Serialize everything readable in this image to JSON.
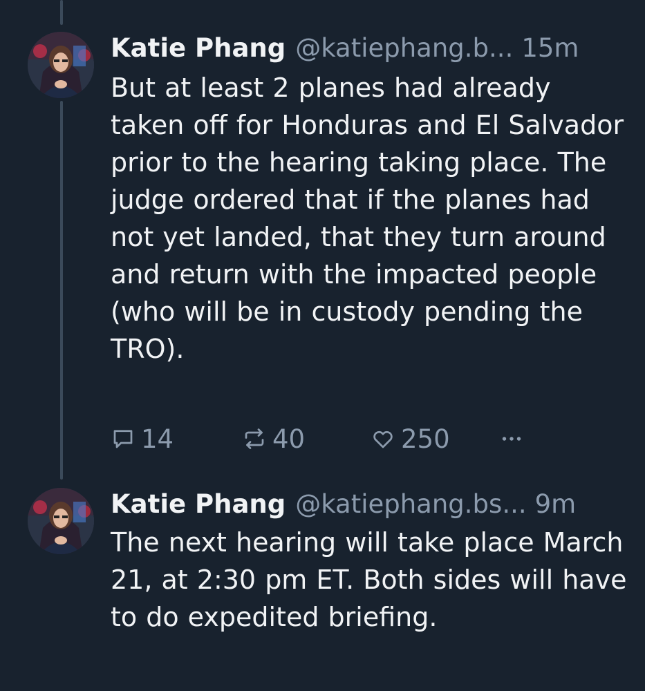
{
  "posts": [
    {
      "author": "Katie Phang",
      "handle": "@katiephang.b...",
      "time": "15m",
      "text": "But at least 2 planes had already taken off for Honduras and El Salvador prior to the hearing taking place. The judge ordered that if the planes had not yet landed, that they turn around and return with the impacted people (who will be in custody pending the TRO).",
      "replies": "14",
      "reposts": "40",
      "likes": "250"
    },
    {
      "author": "Katie Phang",
      "handle": "@katiephang.bs...",
      "time": "9m",
      "text": "The next hearing will take place March 21, at 2:30 pm ET.  Both sides will have to do expedited briefing."
    }
  ],
  "colors": {
    "background": "#18222e",
    "text": "#f1f3f5",
    "muted": "#8c9bad",
    "thread_line": "#3b4a5a"
  },
  "icons": {
    "reply": "speech-bubble-icon",
    "repost": "repost-arrows-icon",
    "like": "heart-icon",
    "more": "ellipsis-icon"
  }
}
